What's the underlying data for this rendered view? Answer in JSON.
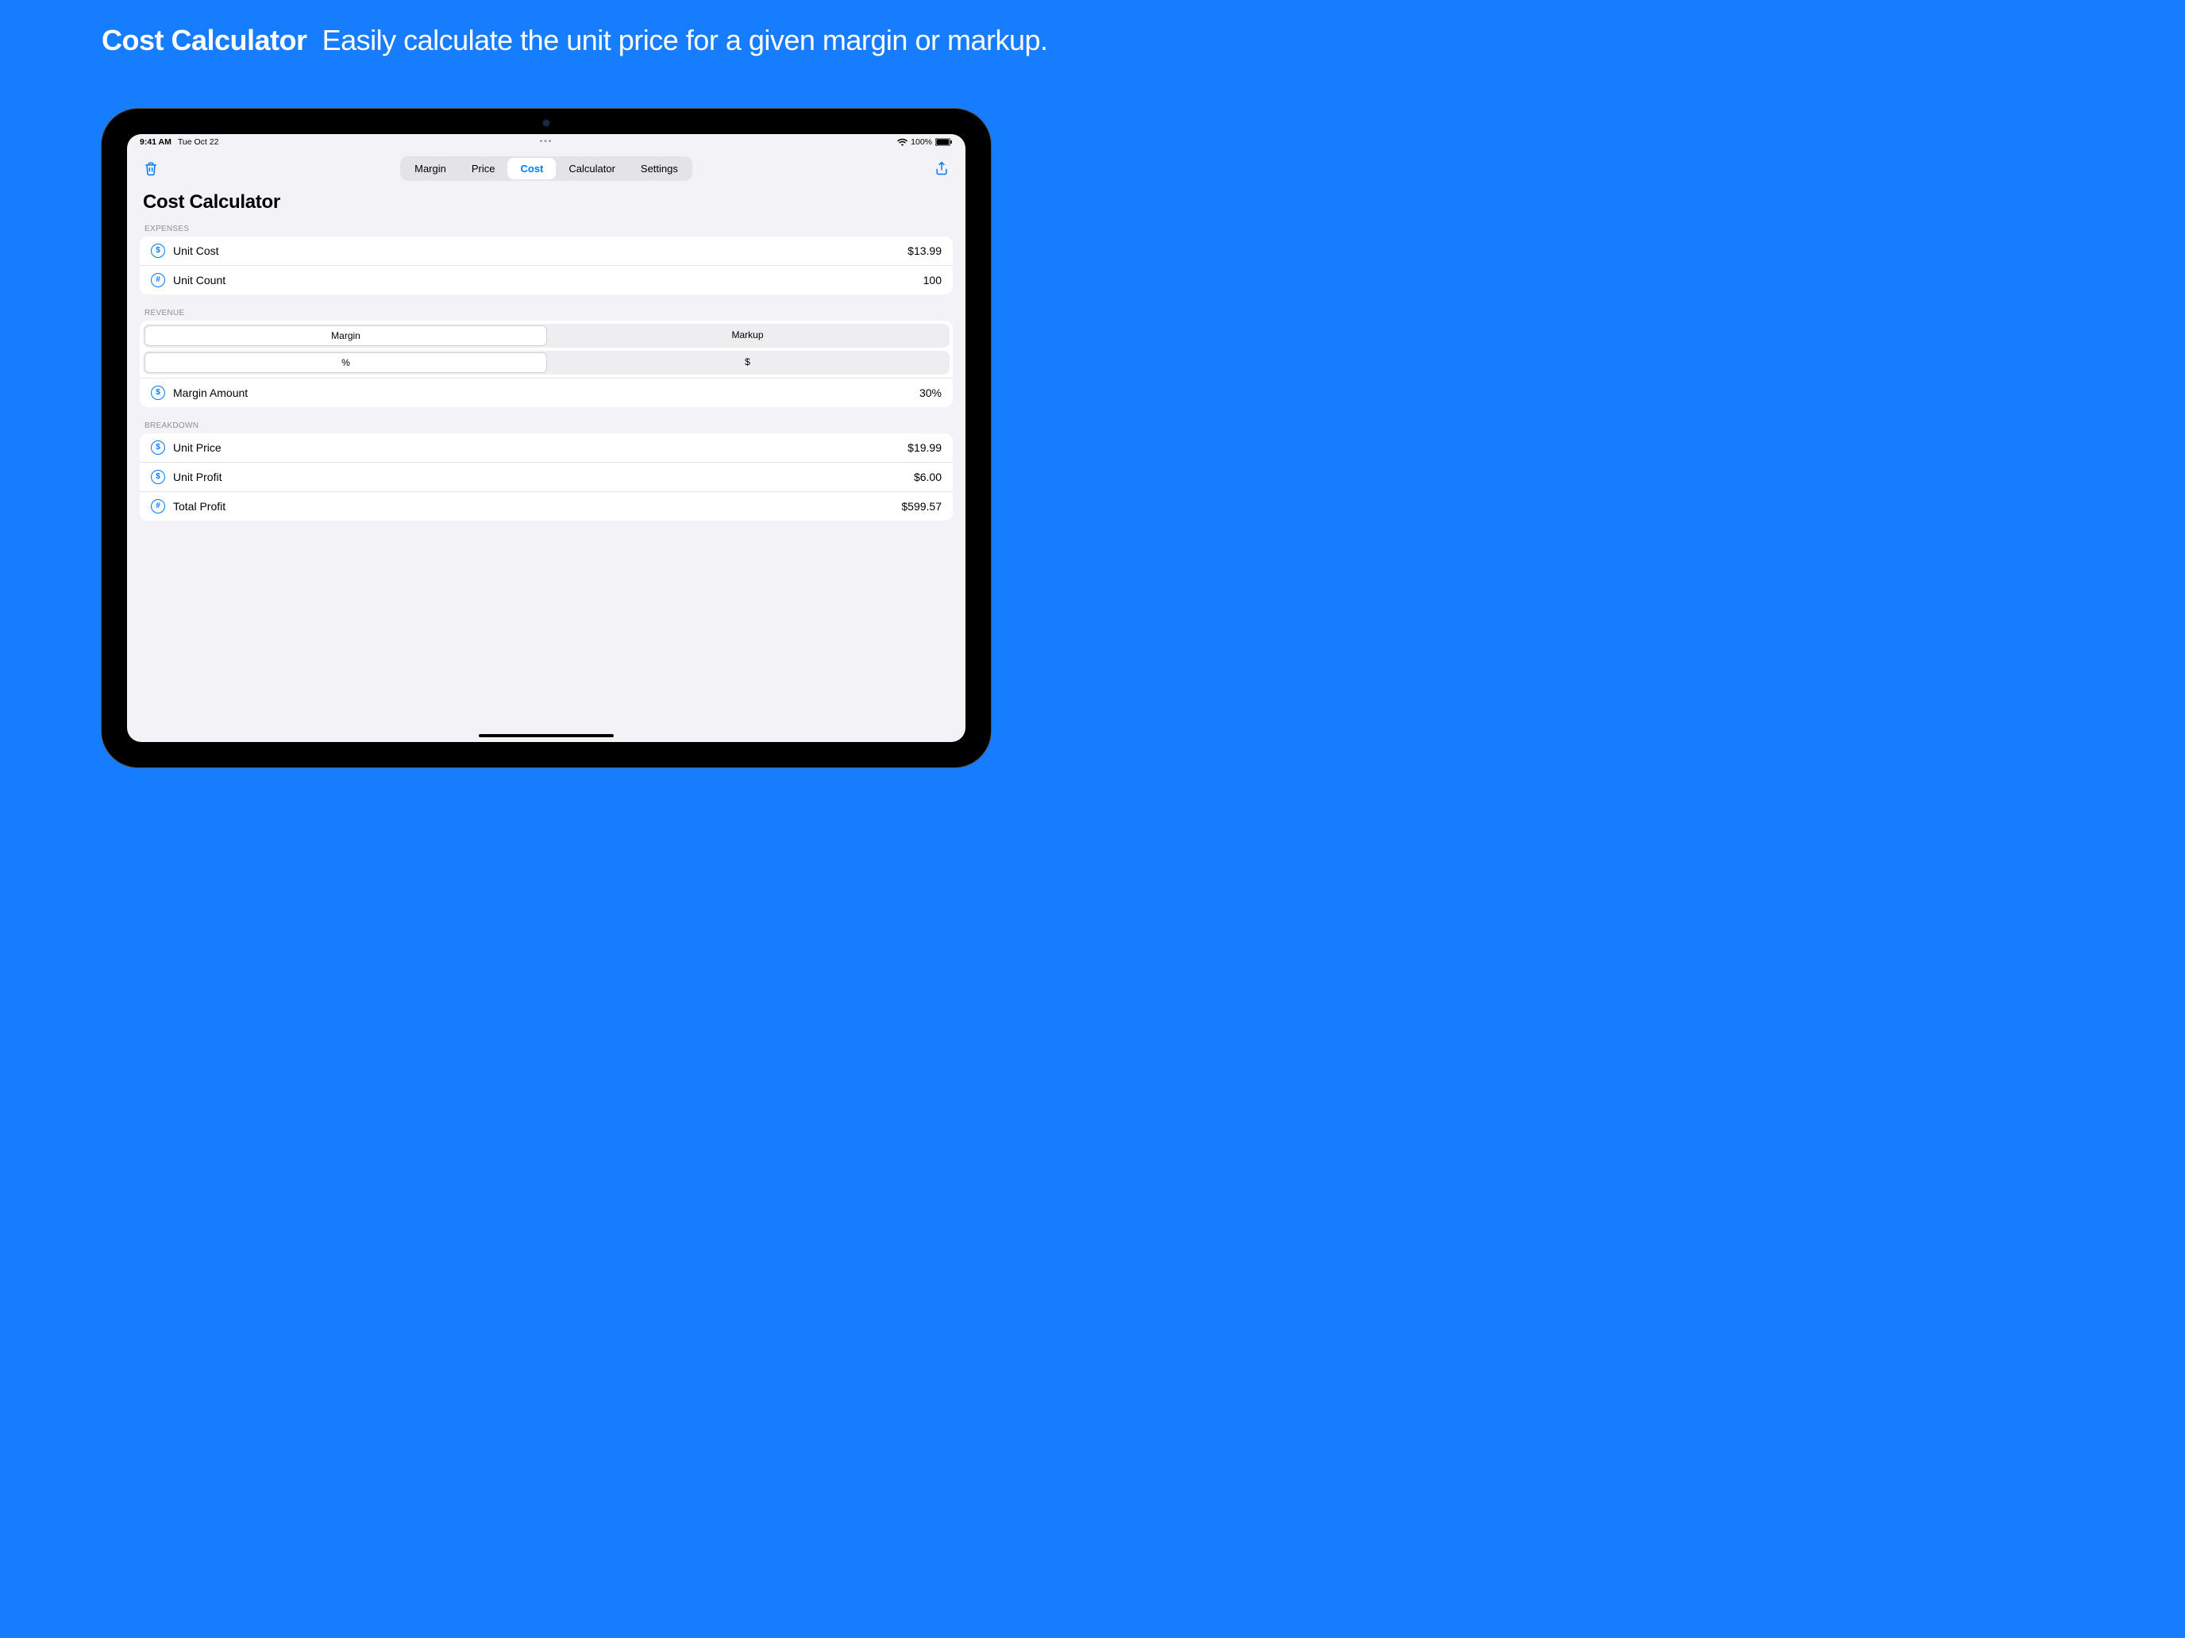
{
  "promo": {
    "title": "Cost Calculator",
    "subtitle": "Easily calculate the unit price for a given margin or markup."
  },
  "status": {
    "time": "9:41 AM",
    "date": "Tue Oct 22",
    "battery": "100%"
  },
  "tabs": {
    "items": [
      "Margin",
      "Price",
      "Cost",
      "Calculator",
      "Settings"
    ],
    "selected": "Cost"
  },
  "page": {
    "title": "Cost Calculator"
  },
  "sections": {
    "expenses": {
      "header": "EXPENSES",
      "rows": [
        {
          "icon": "$",
          "label": "Unit Cost",
          "value": "$13.99"
        },
        {
          "icon": "#",
          "label": "Unit Count",
          "value": "100"
        }
      ]
    },
    "revenue": {
      "header": "REVENUE",
      "toggle1": {
        "options": [
          "Margin",
          "Markup"
        ],
        "selected": "Margin"
      },
      "toggle2": {
        "options": [
          "%",
          "$"
        ],
        "selected": "%"
      },
      "amount": {
        "icon": "$",
        "label": "Margin Amount",
        "value": "30%"
      }
    },
    "breakdown": {
      "header": "BREAKDOWN",
      "rows": [
        {
          "icon": "$",
          "label": "Unit Price",
          "value": "$19.99"
        },
        {
          "icon": "$",
          "label": "Unit Profit",
          "value": "$6.00"
        },
        {
          "icon": "#",
          "label": "Total Profit",
          "value": "$599.57"
        }
      ]
    }
  }
}
